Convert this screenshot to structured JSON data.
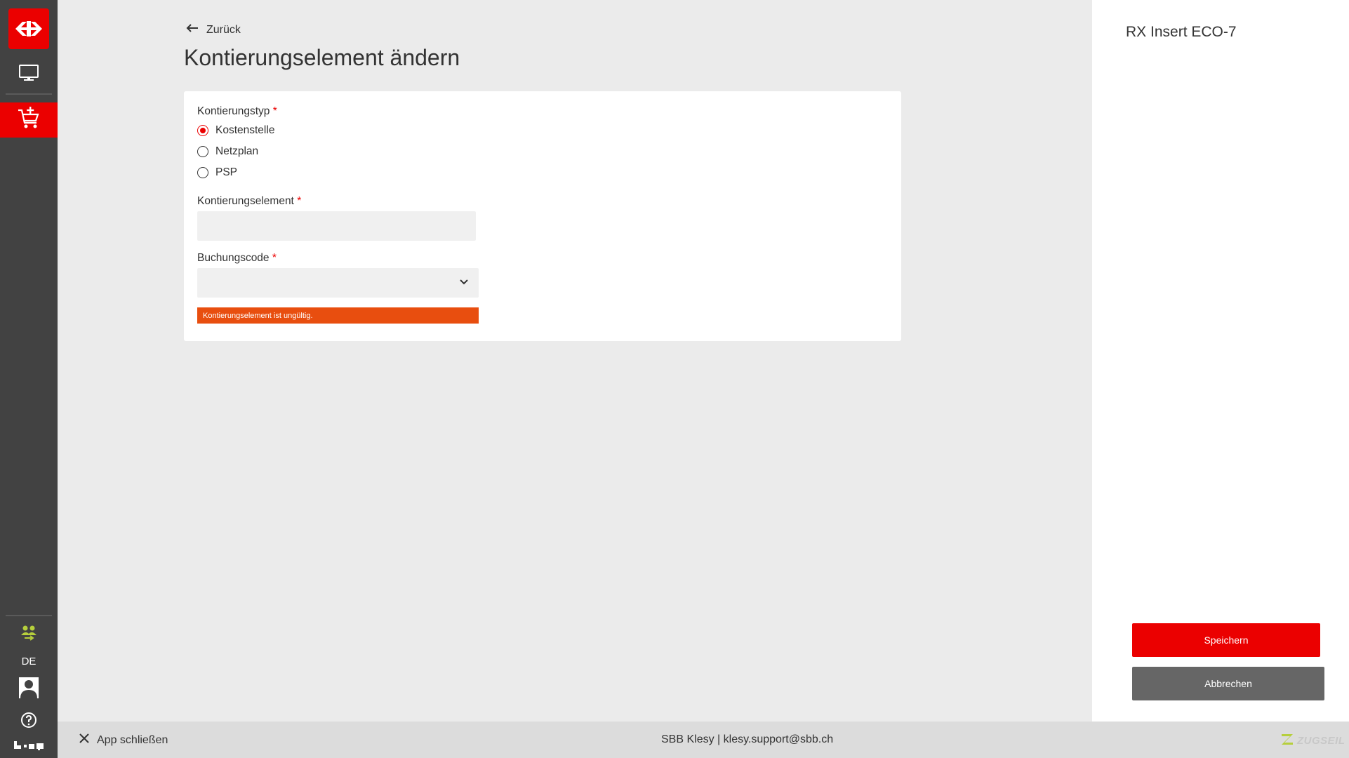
{
  "sidebar": {
    "logo_icon": "sbb-logo-icon",
    "items": [
      {
        "icon": "monitor-icon"
      },
      {
        "icon": "cart-add-icon",
        "active": true
      }
    ],
    "users_icon": "users-icon",
    "language": "DE",
    "avatar_icon": "avatar-icon",
    "help_icon": "help-icon",
    "dots_icon": "dots-icon"
  },
  "header": {
    "back_label": "Zurück",
    "title": "Kontierungselement ändern"
  },
  "form": {
    "kontierungstyp": {
      "label": "Kontierungstyp",
      "required_mark": "*",
      "options": [
        "Kostenstelle",
        "Netzplan",
        "PSP"
      ],
      "selected": "Kostenstelle"
    },
    "kontierungselement": {
      "label": "Kontierungselement",
      "required_mark": "*",
      "value": "",
      "placeholder": ""
    },
    "buchungscode": {
      "label": "Buchungscode",
      "required_mark": "*",
      "value": ""
    },
    "error_message": "Kontierungselement ist ungültig."
  },
  "right_panel": {
    "title": "RX Insert ECO-7",
    "save_label": "Speichern",
    "cancel_label": "Abbrechen"
  },
  "footer": {
    "close_label": "App schließen",
    "center_text": "SBB Klesy | klesy.support@sbb.ch",
    "logo_text": "ZUGSEIL"
  },
  "colors": {
    "accent": "#eb0000",
    "sidebar_bg": "#424242",
    "error_bg": "#e84e0f",
    "cancel_bg": "#666666"
  }
}
